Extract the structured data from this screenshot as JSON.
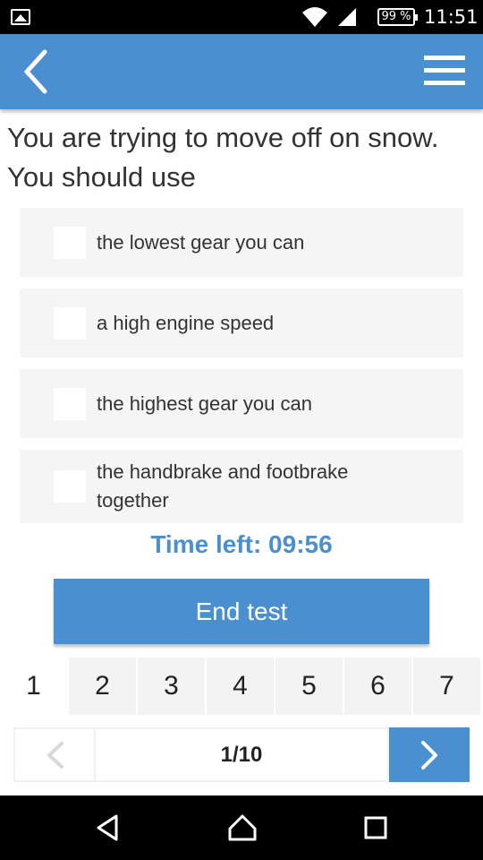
{
  "status_bar": {
    "battery": "99 %",
    "time": "11:51"
  },
  "app_bar": {
    "back_icon": "chevron-left-icon",
    "menu_icon": "hamburger-menu-icon"
  },
  "question": {
    "text": "You are trying to move off on snow. You should use"
  },
  "answers": [
    {
      "label": "the lowest gear you can"
    },
    {
      "label": "a high engine speed"
    },
    {
      "label": "the highest gear you can"
    },
    {
      "label": "the handbrake and footbrake together"
    }
  ],
  "timer": {
    "text": "Time left: 09:56"
  },
  "end_test": {
    "label": "End test"
  },
  "pages": [
    "1",
    "2",
    "3",
    "4",
    "5",
    "6",
    "7"
  ],
  "pager": {
    "counter": "1/10"
  },
  "colors": {
    "accent": "#4a90d0",
    "answer_bg": "#f5f5f5"
  }
}
